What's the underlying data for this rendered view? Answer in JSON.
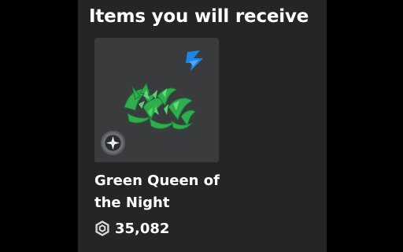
{
  "header": {
    "title": "Items you will receive"
  },
  "item": {
    "name": "Green Queen of the Night",
    "price": "35,082",
    "icons": {
      "badge": "ugc-brand-icon",
      "status": "limited-sparkle-icon",
      "currency": "robux-icon"
    },
    "colors": {
      "plant_light": "#4fd36a",
      "plant_dark": "#1e8d3a",
      "badge_blue": "#1a86e8"
    }
  }
}
